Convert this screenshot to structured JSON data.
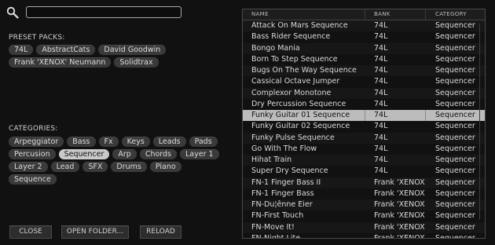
{
  "search": {
    "value": "",
    "placeholder": ""
  },
  "preset_packs": {
    "label": "PRESET PACKS:",
    "items": [
      "74L",
      "AbstractCats",
      "David Goodwin",
      "Frank 'XENOX' Neumann",
      "Solidtrax"
    ]
  },
  "categories": {
    "label": "CATEGORIES:",
    "selected": "Sequencer",
    "items": [
      "Arpeggiator",
      "Bass",
      "Fx",
      "Keys",
      "Leads",
      "Pads",
      "Percusion",
      "Sequencer",
      "Arp",
      "Chords",
      "Layer 1",
      "Layer 2",
      "Lead",
      "SFX",
      "Drums",
      "Piano",
      "Sequence"
    ]
  },
  "buttons": {
    "close": "CLOSE",
    "open_folder": "OPEN FOLDER...",
    "reload": "RELOAD"
  },
  "table": {
    "headers": {
      "name": "NAME",
      "bank": "BANK",
      "category": "CATEGORY"
    },
    "selected_index": 8,
    "rows": [
      {
        "name": "Attack On Mars Sequence",
        "bank": "74L",
        "category": "Sequencer"
      },
      {
        "name": "Bass Rider Sequence",
        "bank": "74L",
        "category": "Sequencer"
      },
      {
        "name": "Bongo Mania",
        "bank": "74L",
        "category": "Sequencer"
      },
      {
        "name": "Born To Step Sequence",
        "bank": "74L",
        "category": "Sequencer"
      },
      {
        "name": "Bugs On The Way Sequence",
        "bank": "74L",
        "category": "Sequencer"
      },
      {
        "name": "Cassical Octave Jumper",
        "bank": "74L",
        "category": "Sequencer"
      },
      {
        "name": "Complexor Monotone",
        "bank": "74L",
        "category": "Sequencer"
      },
      {
        "name": "Dry Percussion Sequence",
        "bank": "74L",
        "category": "Sequencer"
      },
      {
        "name": "Funky Guitar 01 Sequence",
        "bank": "74L",
        "category": "Sequencer"
      },
      {
        "name": "Funky Guitar 02 Sequence",
        "bank": "74L",
        "category": "Sequencer"
      },
      {
        "name": "Funky Pulse Sequence",
        "bank": "74L",
        "category": "Sequencer"
      },
      {
        "name": "Go With The Flow",
        "bank": "74L",
        "category": "Sequencer"
      },
      {
        "name": "Hihat Train",
        "bank": "74L",
        "category": "Sequencer"
      },
      {
        "name": "Super Dry Sequence",
        "bank": "74L",
        "category": "Sequencer"
      },
      {
        "name": "FN-1 Finger Bass II",
        "bank": "Frank 'XENOX' .",
        "category": "Sequencer"
      },
      {
        "name": "FN-1 Finger Bass",
        "bank": "Frank 'XENOX' .",
        "category": "Sequencer"
      },
      {
        "name": "FN-Du¦ênne Eier",
        "bank": "Frank 'XENOX' .",
        "category": "Sequencer"
      },
      {
        "name": "FN-First Touch",
        "bank": "Frank 'XENOX' .",
        "category": "Sequencer"
      },
      {
        "name": "FN-Move It!",
        "bank": "Frank 'XENOX' .",
        "category": "Sequencer"
      },
      {
        "name": "FN-Night Lite",
        "bank": "Frank 'XENOX' .",
        "category": "Sequencer"
      }
    ]
  },
  "colors": {
    "background": "#111111",
    "selected_row": "#bcbcbc",
    "pill": "#3a3a3a",
    "selected_pill": "#c9c9c9"
  }
}
